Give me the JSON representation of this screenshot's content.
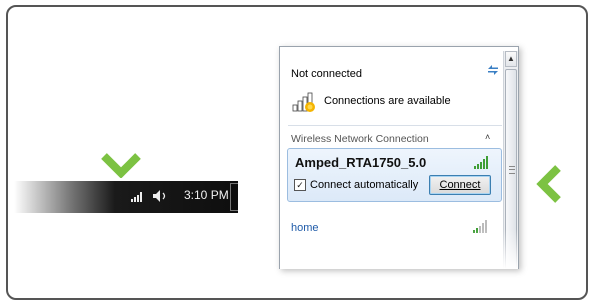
{
  "colors": {
    "accent_green": "#7cc242",
    "link_blue": "#1e5aa8"
  },
  "taskbar": {
    "time": "3:10 PM",
    "icons": [
      "signal-bars-icon",
      "speaker-icon"
    ]
  },
  "popup": {
    "status": "Not connected",
    "availability": "Connections are available",
    "section_header": "Wireless Network Connection",
    "selected_network": {
      "name": "Amped_RTA1750_5.0",
      "auto_label": "Connect automatically",
      "auto_checked": true,
      "checkbox_mark": "✓",
      "connect_label": "Connect"
    },
    "other_network": {
      "name": "home"
    },
    "collapse_symbol": "˄",
    "scroll_up_symbol": "▲"
  }
}
